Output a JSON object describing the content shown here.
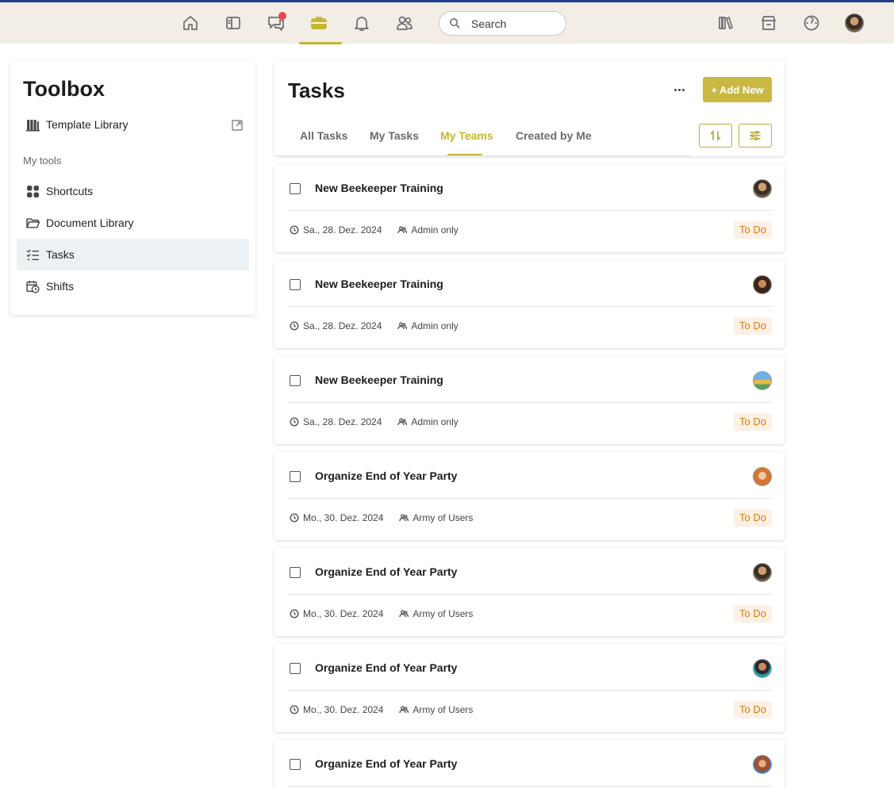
{
  "topbar": {
    "search_placeholder": "Search",
    "accent_color": "#c5b52f",
    "nav_icons": [
      "home-icon",
      "sidebar-icon",
      "chat-icon",
      "toolbox-icon",
      "bell-icon",
      "people-icon"
    ],
    "right_icons": [
      "library-icon",
      "store-icon",
      "dashboard-icon"
    ]
  },
  "toolbox": {
    "title": "Toolbox",
    "template_library": "Template Library",
    "section_label": "My tools",
    "items": [
      {
        "label": "Shortcuts",
        "icon": "grid-icon"
      },
      {
        "label": "Document Library",
        "icon": "folder-icon"
      },
      {
        "label": "Tasks",
        "icon": "checklist-icon",
        "active": true
      },
      {
        "label": "Shifts",
        "icon": "calendar-clock-icon"
      }
    ]
  },
  "tasks": {
    "title": "Tasks",
    "add_new": "+ Add New",
    "tabs": [
      "All Tasks",
      "My Tasks",
      "My Teams",
      "Created by Me"
    ],
    "active_tab": "My Teams",
    "list": [
      {
        "title": "New Beekeeper Training",
        "date": "Sa., 28. Dez. 2024",
        "group": "Admin only",
        "status": "To Do"
      },
      {
        "title": "New Beekeeper Training",
        "date": "Sa., 28. Dez. 2024",
        "group": "Admin only",
        "status": "To Do"
      },
      {
        "title": "New Beekeeper Training",
        "date": "Sa., 28. Dez. 2024",
        "group": "Admin only",
        "status": "To Do"
      },
      {
        "title": "Organize End of Year Party",
        "date": "Mo., 30. Dez. 2024",
        "group": "Army of Users",
        "status": "To Do"
      },
      {
        "title": "Organize End of Year Party",
        "date": "Mo., 30. Dez. 2024",
        "group": "Army of Users",
        "status": "To Do"
      },
      {
        "title": "Organize End of Year Party",
        "date": "Mo., 30. Dez. 2024",
        "group": "Army of Users",
        "status": "To Do"
      },
      {
        "title": "Organize End of Year Party"
      }
    ]
  }
}
